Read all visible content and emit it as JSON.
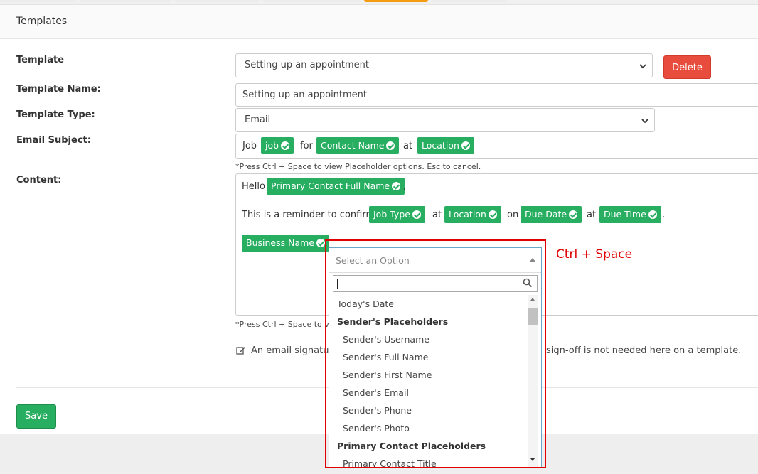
{
  "panel": {
    "title": "Templates"
  },
  "form": {
    "template_label": "Template",
    "template_value": "Setting up an appointment",
    "delete_label": "Delete",
    "name_label": "Template Name:",
    "name_value": "Setting up an appointment",
    "type_label": "Template Type:",
    "type_value": "Email",
    "subject_label": "Email Subject:",
    "subject": {
      "t1": "Job",
      "c1": "job",
      "t2": "for",
      "c2": "Contact Name",
      "t3": "at",
      "c3": "Location"
    },
    "hint": "*Press Ctrl + Space to view Placeholder options. Esc to cancel.",
    "hint_truncated": "*Press Ctrl + Space to vie",
    "content_label": "Content:",
    "content": {
      "hello": "Hello",
      "c_primary": "Primary Contact Full Name",
      "comma": ",",
      "reminder": "This is a reminder to confirm",
      "c_jobtype": "Job Type",
      "at1": "at",
      "c_location": "Location",
      "on": "on",
      "c_duedate": "Due Date",
      "at2": "at",
      "c_duetime": "Due Time",
      "period": ".",
      "c_business": "Business Name"
    },
    "note_start": "An email signatu",
    "note_end": "sign-off is not needed here on a template.",
    "save_label": "Save"
  },
  "dropdown": {
    "placeholder": "Select an Option",
    "items": [
      {
        "label": "Today's Date",
        "kind": "option"
      },
      {
        "label": "Sender's Placeholders",
        "kind": "group"
      },
      {
        "label": "Sender's Username",
        "kind": "sub"
      },
      {
        "label": "Sender's Full Name",
        "kind": "sub"
      },
      {
        "label": "Sender's First Name",
        "kind": "sub"
      },
      {
        "label": "Sender's Email",
        "kind": "sub"
      },
      {
        "label": "Sender's Phone",
        "kind": "sub"
      },
      {
        "label": "Sender's Photo",
        "kind": "sub"
      },
      {
        "label": "Primary Contact Placeholders",
        "kind": "group"
      },
      {
        "label": "Primary Contact Title",
        "kind": "sub"
      }
    ]
  },
  "annotation": {
    "text": "Ctrl + Space",
    "color": "#e00000"
  },
  "colors": {
    "chip": "#27ae60",
    "delete": "#e74c3c",
    "save": "#27ae60",
    "tab_active": "#f39c12"
  }
}
